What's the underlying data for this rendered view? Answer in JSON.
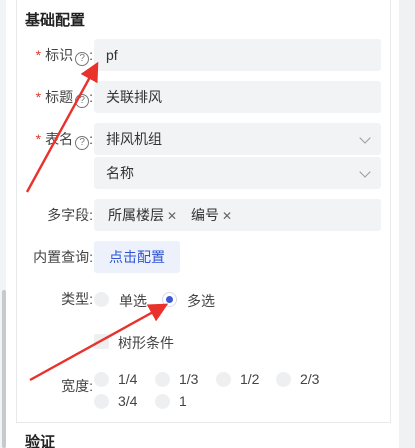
{
  "section_basic": "基础配置",
  "fields": {
    "identifier": {
      "label": "标识",
      "colon": ":",
      "value": "pf"
    },
    "title": {
      "label": "标题",
      "colon": ":",
      "value": "关联排风"
    },
    "table_name": {
      "label": "表名",
      "colon": ":",
      "value": "排风机组",
      "column_value": "名称"
    },
    "multi_field": {
      "label": "多字段:",
      "tags": [
        "所属楼层",
        "编号"
      ]
    },
    "builtin_query": {
      "label": "内置查询:",
      "button": "点击配置"
    },
    "type": {
      "label": "类型:",
      "options": [
        "单选",
        "多选"
      ],
      "selected": "多选"
    },
    "tree_condition": {
      "label": "树形条件",
      "checked": false
    },
    "width": {
      "label": "宽度:",
      "options": [
        "1/4",
        "1/3",
        "1/2",
        "2/3",
        "3/4",
        "1"
      ],
      "selected": null
    }
  },
  "section_validation": "验证",
  "colors": {
    "accent": "#3b5bd6",
    "required": "#e0362b",
    "annotation_arrow": "#e8322b"
  }
}
